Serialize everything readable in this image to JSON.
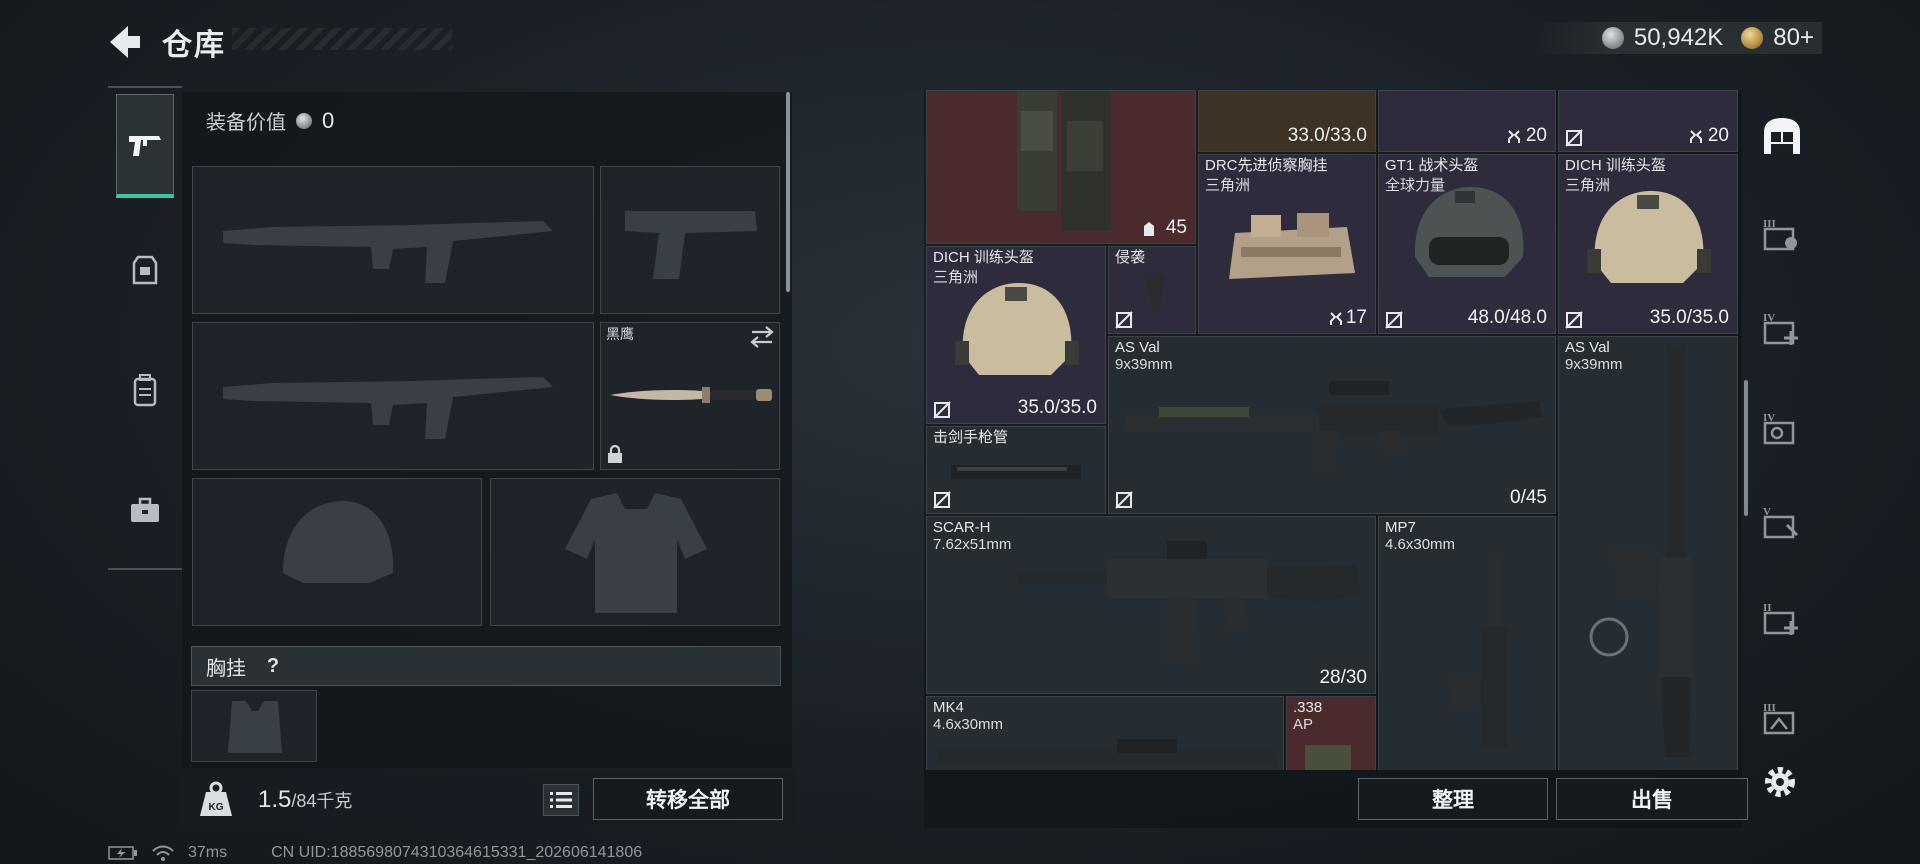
{
  "header": {
    "title": "仓库"
  },
  "currency": {
    "silver_value": "50,942K",
    "gold_value": "80",
    "gold_plus": "+"
  },
  "loadout": {
    "equip_value_label": "装备价值",
    "equip_value": "0",
    "knife_name": "黑鹰",
    "chest_rig_label": "胸挂",
    "chest_rig_help": "?"
  },
  "weight": {
    "current": "1.5",
    "max": "/84千克"
  },
  "buttons": {
    "transfer_all": "转移全部",
    "sort": "整理",
    "sell": "出售"
  },
  "status": {
    "ping": "37ms",
    "uid": "CN UID:1885698074310364615331_202606141806"
  },
  "inventory": {
    "r1c2_value": "33.0/33.0",
    "r1c3_value": "20",
    "r1c4_value": "20",
    "vest_count": "45",
    "drc_name": "DRC先进侦察胸挂",
    "drc_sub": "三角洲",
    "drc_value": "17",
    "gt1_name": "GT1 战术头盔",
    "gt1_sub": "全球力量",
    "gt1_value": "48.0/48.0",
    "dich1_name": "DICH 训练头盔",
    "dich1_sub": "三角洲",
    "dich1_value": "35.0/35.0",
    "dich2_name": "DICH 训练头盔",
    "dich2_sub": "三角洲",
    "dich2_value": "35.0/35.0",
    "grip_name": "侵袭",
    "asval1_name": "AS Val",
    "asval1_sub": "9x39mm",
    "asval1_value": "0/45",
    "asval2_name": "AS Val",
    "asval2_sub": "9x39mm",
    "barrel_name": "击剑手枪管",
    "scar_name": "SCAR-H",
    "scar_sub": "7.62x51mm",
    "scar_value": "28/30",
    "mp7_name": "MP7",
    "mp7_sub": "4.6x30mm",
    "mk4_name": "MK4",
    "mk4_sub": "4.6x30mm",
    "ammo_name": ".338",
    "ammo_sub": "AP"
  },
  "right_tabs": [
    "III",
    "IV",
    "IV",
    "V",
    "II",
    "III"
  ],
  "colors": {
    "accent_active": "#38c9a8",
    "cell_purple": "#2e2c3c",
    "cell_red": "#4a2a2c"
  }
}
